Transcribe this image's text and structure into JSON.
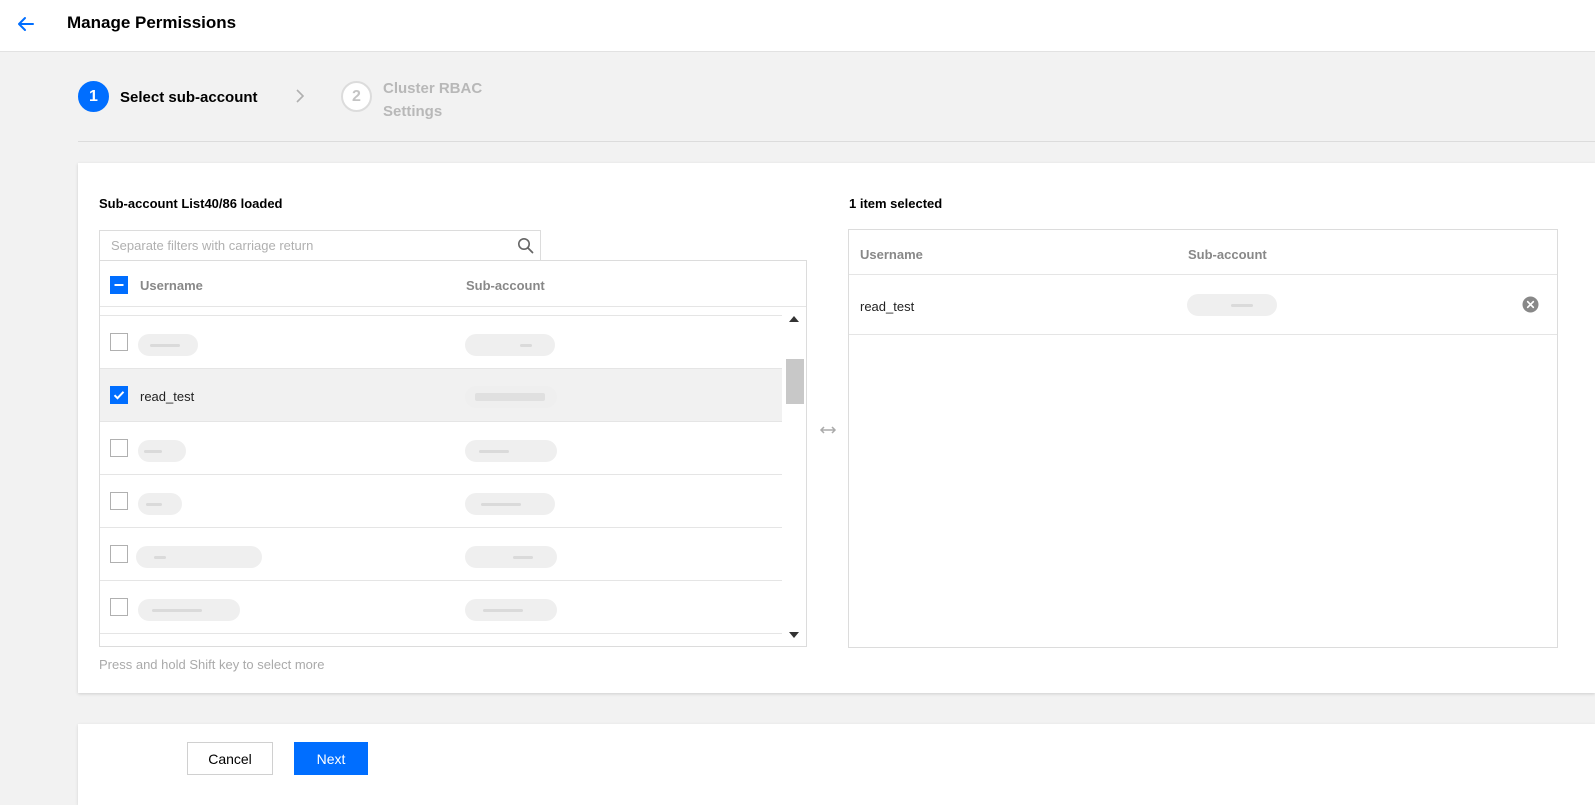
{
  "header": {
    "title": "Manage Permissions",
    "back_icon": "arrow-left-icon"
  },
  "steps": [
    {
      "number": "1",
      "label": "Select sub-account",
      "state": "active"
    },
    {
      "number": "2",
      "label": "Cluster RBAC Settings",
      "state": "inactive"
    }
  ],
  "sub_account_list": {
    "title": "Sub-account List40/86 loaded",
    "search_placeholder": "Separate filters with carriage return",
    "columns": [
      "Username",
      "Sub-account"
    ],
    "select_all_state": "partial",
    "rows": [
      {
        "username": "",
        "sub_account": "",
        "checked": false,
        "redacted": true
      },
      {
        "username": "read_test",
        "sub_account": "",
        "checked": true,
        "redacted": false
      },
      {
        "username": "",
        "sub_account": "",
        "checked": false,
        "redacted": true
      },
      {
        "username": "",
        "sub_account": "",
        "checked": false,
        "redacted": true
      },
      {
        "username": "",
        "sub_account": "",
        "checked": false,
        "redacted": true
      },
      {
        "username": "",
        "sub_account": "",
        "checked": false,
        "redacted": true
      }
    ],
    "hint": "Press and hold Shift key to select more"
  },
  "selected_list": {
    "title": "1 item selected",
    "columns": [
      "Username",
      "Sub-account"
    ],
    "rows": [
      {
        "username": "read_test",
        "sub_account": ""
      }
    ]
  },
  "footer": {
    "cancel_label": "Cancel",
    "next_label": "Next"
  },
  "colors": {
    "accent": "#006eff",
    "selected_row": "#f1f1f1",
    "background": "#f2f2f2"
  }
}
